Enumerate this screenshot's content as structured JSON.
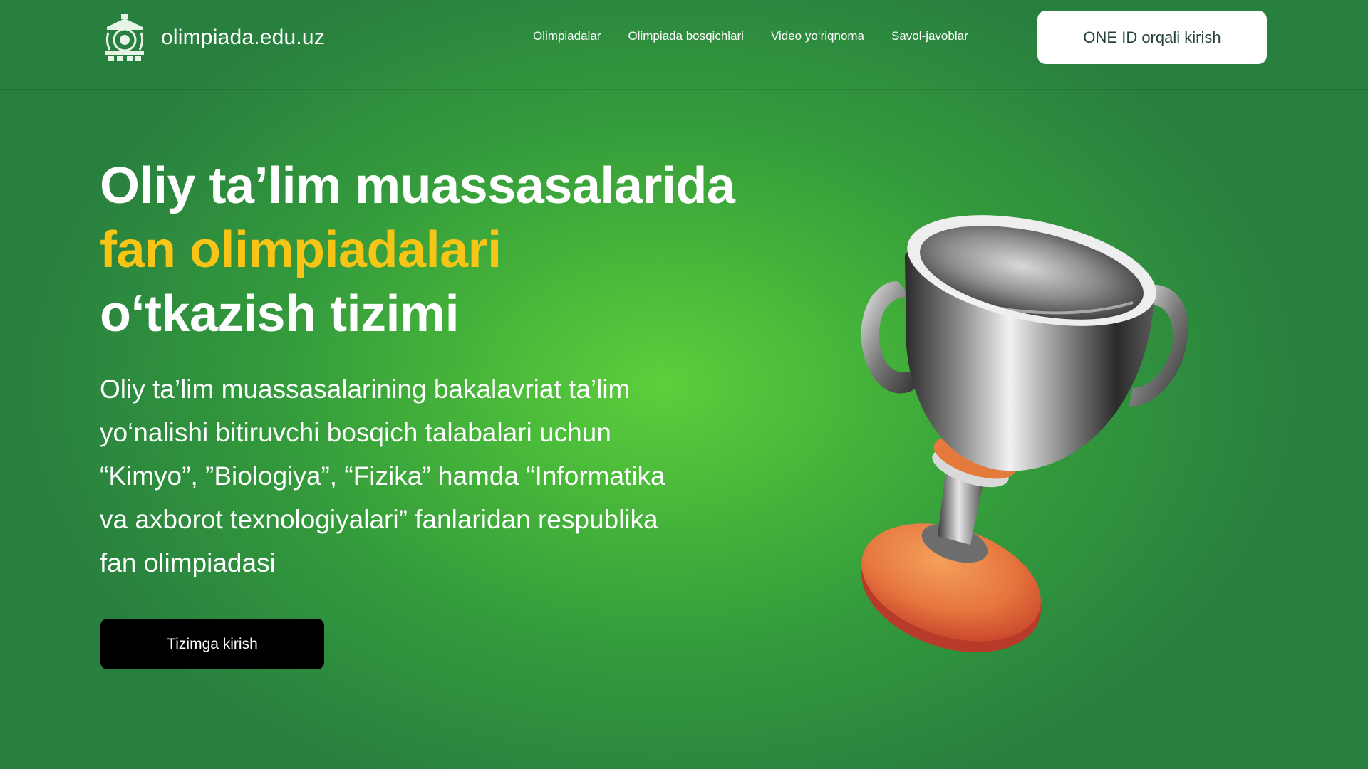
{
  "header": {
    "site_name": "olimpiada.edu.uz",
    "logo_icon": "emblem-icon",
    "nav": [
      {
        "label": "Olimpiadalar"
      },
      {
        "label": "Olimpiada bosqichlari"
      },
      {
        "label": "Video yo‘riqnoma"
      },
      {
        "label": "Savol-javoblar"
      }
    ],
    "login_label": "ONE ID orqali kirish"
  },
  "hero": {
    "title_line1": "Oliy ta’lim muassasalarida",
    "title_line2": "fan olimpiadalari",
    "title_line3": "o‘tkazish tizimi",
    "description": "Oliy ta’lim muassasalarining bakalavriat ta’lim yo‘nalishi bitiruvchi bosqich talabalari uchun “Kimyo”, ”Biologiya”, “Fizika” hamda “Informatika va axborot texnologiyalari” fanlaridan respublika fan olimpiadasi",
    "cta_label": "Tizimga kirish",
    "image_icon": "trophy-icon"
  },
  "colors": {
    "background_center": "#5ccf3c",
    "background_edge": "#28803f",
    "accent": "#f8c516",
    "button_dark": "#000000",
    "button_light": "#ffffff"
  }
}
